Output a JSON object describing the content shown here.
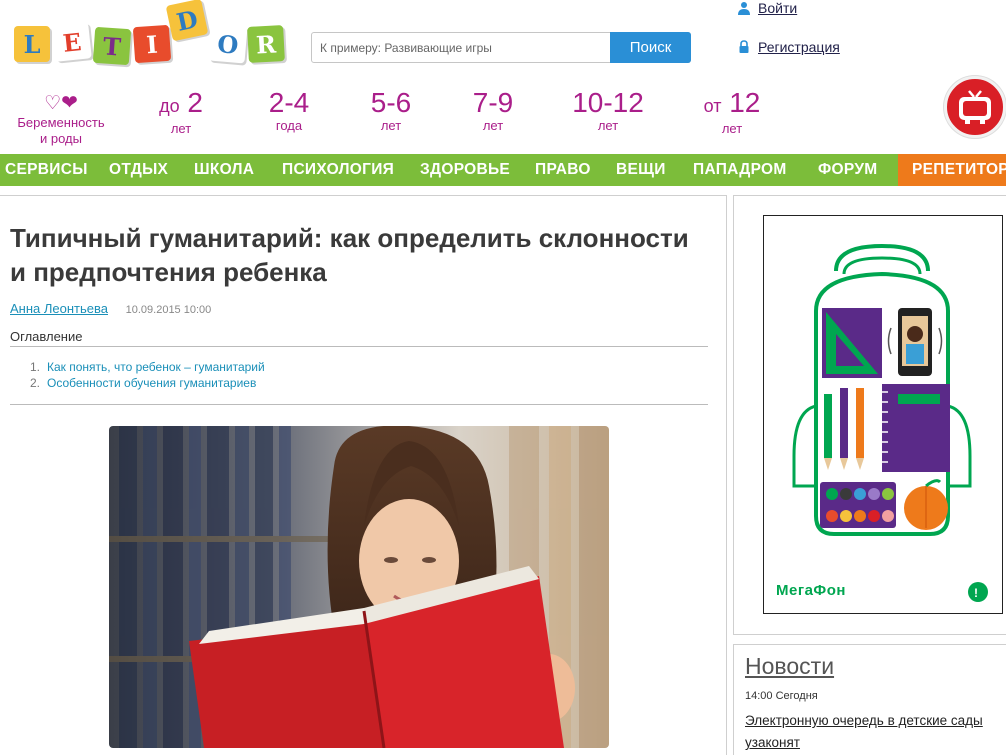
{
  "logo": {
    "letters": [
      {
        "ch": "L",
        "bg": "#f6c23b",
        "fg": "#2e7bc0"
      },
      {
        "ch": "E",
        "bg": "#ffffff",
        "fg": "#e23e2b"
      },
      {
        "ch": "T",
        "bg": "#8ac43f",
        "fg": "#7b2b8a"
      },
      {
        "ch": "I",
        "bg": "#e84c2c",
        "fg": "#ffffff"
      },
      {
        "ch": "D",
        "bg": "#f6c23b",
        "fg": "#2e7bc0"
      },
      {
        "ch": "O",
        "bg": "#ffffff",
        "fg": "#2e7bc0"
      },
      {
        "ch": "R",
        "bg": "#8ac43f",
        "fg": "#ffffff"
      }
    ]
  },
  "search": {
    "placeholder": "К примеру: Развивающие игры",
    "button": "Поиск"
  },
  "auth": {
    "login": "Войти",
    "register": "Регистрация"
  },
  "pregnancy": {
    "line1": "Беременность",
    "line2": "и роды"
  },
  "ages": [
    {
      "prefix": "до",
      "num": "2",
      "sub": "лет"
    },
    {
      "prefix": "",
      "num": "2-4",
      "sub": "года"
    },
    {
      "prefix": "",
      "num": "5-6",
      "sub": "лет"
    },
    {
      "prefix": "",
      "num": "7-9",
      "sub": "лет"
    },
    {
      "prefix": "",
      "num": "10-12",
      "sub": "лет"
    },
    {
      "prefix": "от",
      "num": "12",
      "sub": "лет"
    }
  ],
  "menu": [
    "СЕРВИСЫ",
    "ОТДЫХ",
    "ШКОЛА",
    "ПСИХОЛОГИЯ",
    "ЗДОРОВЬЕ",
    "ПРАВО",
    "ВЕЩИ",
    "ПАПАДРОМ",
    "ФОРУМ",
    "РЕПЕТИТОРЫ"
  ],
  "article": {
    "title": "Типичный гуманитарий: как определить склонности и предпочтения ребенка",
    "author": "Анна Леонтьева",
    "date": "10.09.2015 10:00",
    "toc_heading": "Оглавление",
    "toc": [
      {
        "n": "1.",
        "text": "Как понять, что ребенок – гуманитарий"
      },
      {
        "n": "2.",
        "text": "Особенности обучения гуманитариев"
      }
    ]
  },
  "ad": {
    "brand": "МегаФон"
  },
  "news": {
    "title": "Новости",
    "time": "14:00 Сегодня",
    "link": "Электронную очередь в детские сады узаконят"
  },
  "colors": {
    "menu_green": "#7cbd3a",
    "menu_orange": "#ee7a1b",
    "age_purple": "#aa1e8a",
    "search_blue": "#2a8fd6",
    "link_blue": "#1a8fb8",
    "megafon_green": "#00a650"
  }
}
